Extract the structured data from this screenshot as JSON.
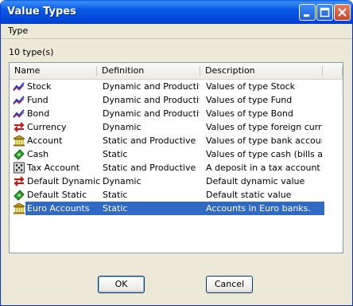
{
  "window": {
    "title": "Value Types"
  },
  "menu": [
    {
      "label": "Type"
    }
  ],
  "count_label": "10 type(s)",
  "columns": [
    "Name",
    "Definition",
    "Description"
  ],
  "rows": [
    {
      "icon": "stock-chart-icon",
      "name": "Stock",
      "definition": "Dynamic and Productive",
      "description": "Values of type Stock"
    },
    {
      "icon": "fund-chart-icon",
      "name": "Fund",
      "definition": "Dynamic and Productive",
      "description": "Values of type Fund"
    },
    {
      "icon": "bond-chart-icon",
      "name": "Bond",
      "definition": "Dynamic and Productive",
      "description": "Values of type Bond"
    },
    {
      "icon": "currency-exchange-icon",
      "name": "Currency",
      "definition": "Dynamic",
      "description": "Values of type foreign curre..."
    },
    {
      "icon": "bank-icon",
      "name": "Account",
      "definition": "Static and Productive",
      "description": "Values of type bank accounts"
    },
    {
      "icon": "cash-banknote-icon",
      "name": "Cash",
      "definition": "Static",
      "description": "Values of type cash (bills an..."
    },
    {
      "icon": "tax-dice-icon",
      "name": "Tax Account",
      "definition": "Static and Productive",
      "description": "A deposit in a tax account e..."
    },
    {
      "icon": "dynamic-arrows-icon",
      "name": "Default Dynamic",
      "definition": "Dynamic",
      "description": "Default dynamic value"
    },
    {
      "icon": "static-banknote-icon",
      "name": "Default Static",
      "definition": "Static",
      "description": "Default static value"
    },
    {
      "icon": "bank-icon",
      "name": "Euro Accounts",
      "definition": "Static",
      "description": "Accounts in Euro banks.",
      "selected": true
    }
  ],
  "buttons": {
    "ok": "OK",
    "cancel": "Cancel"
  },
  "colors": {
    "selection": "#316ac5",
    "titlebar": "#0a5ae8"
  }
}
